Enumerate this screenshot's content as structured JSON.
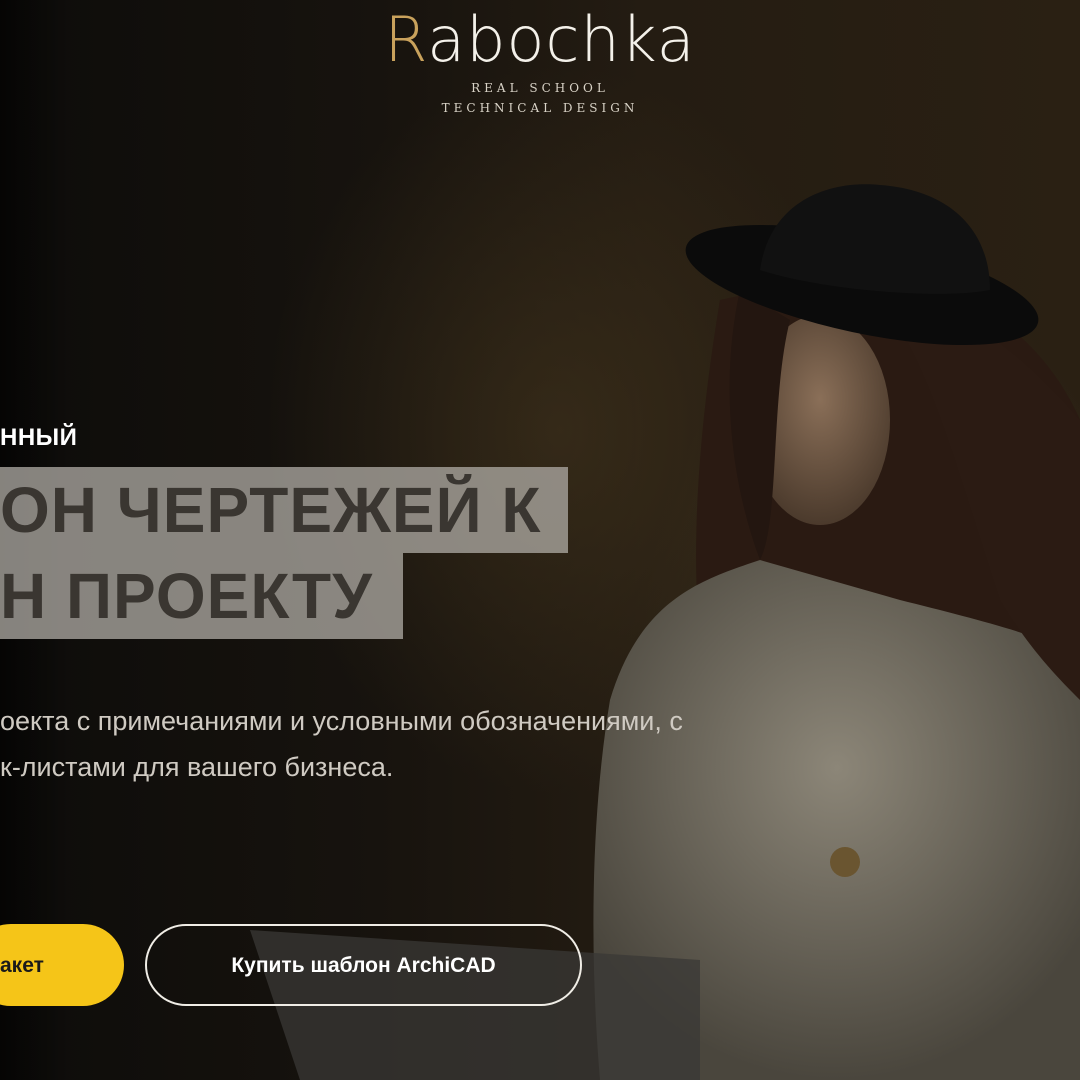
{
  "header": {
    "logo_first_letter": "R",
    "logo_rest": "abochka",
    "logo_line1": "REAL SCHOOL",
    "logo_line2": "TECHNICAL DESIGN"
  },
  "hero": {
    "eyebrow": "ННЫЙ",
    "title_line1": "ОН ЧЕРТЕЖЕЙ К",
    "title_line2": "Н ПРОЕКТУ",
    "description_line1": "оекта с примечаниями и условными обозначениями, с",
    "description_line2": "к-листами для вашего бизнеса.",
    "primary_button": "акет",
    "secondary_button": "Купить шаблон ArchiCAD"
  },
  "colors": {
    "accent_yellow": "#f5c518",
    "logo_gold": "#c9a25c",
    "title_highlight": "#aaa6a0"
  }
}
